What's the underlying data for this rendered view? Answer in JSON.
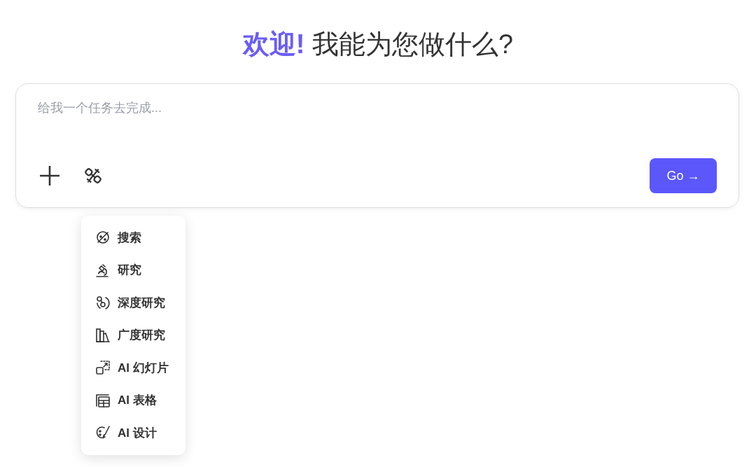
{
  "heading": {
    "accent": "欢迎!",
    "rest": "我能为您做什么?"
  },
  "composer": {
    "placeholder": "给我一个任务去完成...",
    "go_button": {
      "label": "Go",
      "arrow": "→"
    }
  },
  "menu": {
    "items": [
      {
        "kind": "search",
        "label": "搜索"
      },
      {
        "kind": "research",
        "label": "研究"
      },
      {
        "kind": "deep",
        "label": "深度研究"
      },
      {
        "kind": "wide",
        "label": "广度研究"
      },
      {
        "kind": "slides",
        "label": "AI 幻灯片"
      },
      {
        "kind": "sheet",
        "label": "AI 表格"
      },
      {
        "kind": "design",
        "label": "AI 设计"
      }
    ]
  }
}
